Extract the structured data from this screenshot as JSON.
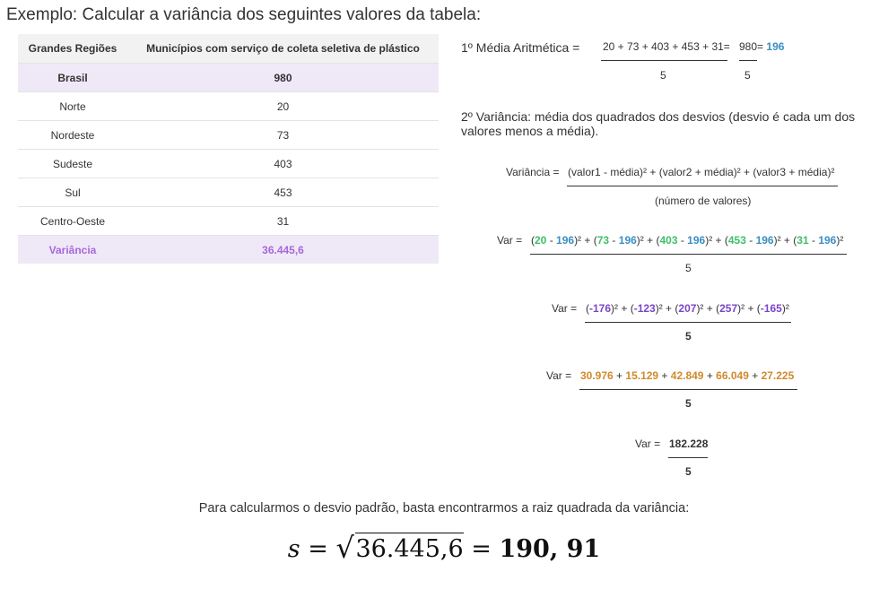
{
  "title": "Exemplo: Calcular a variância dos seguintes valores da tabela:",
  "table": {
    "headers": [
      "Grandes Regiões",
      "Municípios com serviço de coleta seletiva de plástico"
    ],
    "rows": [
      [
        "Brasil",
        "980"
      ],
      [
        "Norte",
        "20"
      ],
      [
        "Nordeste",
        "73"
      ],
      [
        "Sudeste",
        "403"
      ],
      [
        "Sul",
        "453"
      ],
      [
        "Centro-Oeste",
        "31"
      ],
      [
        "Variância",
        "36.445,6"
      ]
    ]
  },
  "step1": {
    "label": "1º Média Aritmética =",
    "numerator": "20 + 73 + 403 + 453 + 31=",
    "denominator": "5",
    "num2": "980",
    "eq": "=",
    "result": "196",
    "den2": "5"
  },
  "step2": {
    "text": "2º Variância: média dos quadrados dos desvios (desvio é cada um dos valores menos a média).",
    "formula_label": "Variância =",
    "formula_num": "(valor1 - média)² + (valor2 + média)² + (valor3 + média)²",
    "formula_den": "(número de valores)"
  },
  "var_steps": {
    "label": "Var =",
    "denominator": "5",
    "step_a": [
      "20",
      "196",
      "73",
      "196",
      "403",
      "196",
      "453",
      "196",
      "31",
      "196"
    ],
    "step_b": [
      "-176",
      "-123",
      "207",
      "257",
      "-165"
    ],
    "step_c": [
      "30.976",
      "15.129",
      "42.849",
      "66.049",
      "27.225"
    ],
    "step_d": "182.228"
  },
  "conclusion": "Para calcularmos o desvio padrão, basta encontrarmos a raiz quadrada da variância:",
  "stdev": {
    "symbol": "s",
    "eq1": "=",
    "radicand": "36.445,6",
    "eq2": "=",
    "result": "190, 91"
  },
  "colors": {
    "green": "#3fbf6a",
    "blue": "#3a8fc2",
    "purple": "#7b45c9",
    "orange": "#d08a2c",
    "highlight_row": "#efe9f7",
    "variance_text": "#a768d9"
  }
}
